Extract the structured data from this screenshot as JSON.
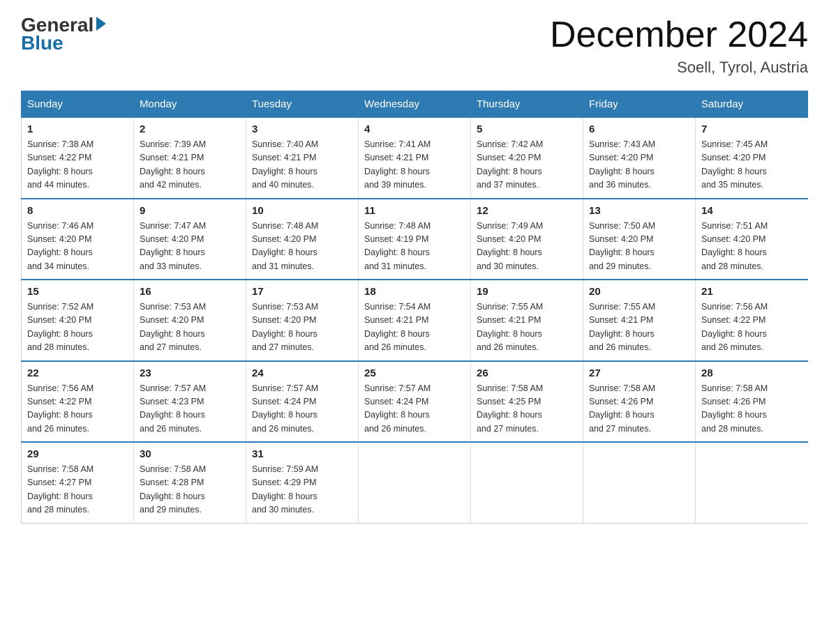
{
  "logo": {
    "general": "General",
    "blue": "Blue"
  },
  "title": "December 2024",
  "location": "Soell, Tyrol, Austria",
  "days_of_week": [
    "Sunday",
    "Monday",
    "Tuesday",
    "Wednesday",
    "Thursday",
    "Friday",
    "Saturday"
  ],
  "weeks": [
    [
      {
        "day": "1",
        "sunrise": "7:38 AM",
        "sunset": "4:22 PM",
        "daylight": "8 hours and 44 minutes."
      },
      {
        "day": "2",
        "sunrise": "7:39 AM",
        "sunset": "4:21 PM",
        "daylight": "8 hours and 42 minutes."
      },
      {
        "day": "3",
        "sunrise": "7:40 AM",
        "sunset": "4:21 PM",
        "daylight": "8 hours and 40 minutes."
      },
      {
        "day": "4",
        "sunrise": "7:41 AM",
        "sunset": "4:21 PM",
        "daylight": "8 hours and 39 minutes."
      },
      {
        "day": "5",
        "sunrise": "7:42 AM",
        "sunset": "4:20 PM",
        "daylight": "8 hours and 37 minutes."
      },
      {
        "day": "6",
        "sunrise": "7:43 AM",
        "sunset": "4:20 PM",
        "daylight": "8 hours and 36 minutes."
      },
      {
        "day": "7",
        "sunrise": "7:45 AM",
        "sunset": "4:20 PM",
        "daylight": "8 hours and 35 minutes."
      }
    ],
    [
      {
        "day": "8",
        "sunrise": "7:46 AM",
        "sunset": "4:20 PM",
        "daylight": "8 hours and 34 minutes."
      },
      {
        "day": "9",
        "sunrise": "7:47 AM",
        "sunset": "4:20 PM",
        "daylight": "8 hours and 33 minutes."
      },
      {
        "day": "10",
        "sunrise": "7:48 AM",
        "sunset": "4:20 PM",
        "daylight": "8 hours and 31 minutes."
      },
      {
        "day": "11",
        "sunrise": "7:48 AM",
        "sunset": "4:19 PM",
        "daylight": "8 hours and 31 minutes."
      },
      {
        "day": "12",
        "sunrise": "7:49 AM",
        "sunset": "4:20 PM",
        "daylight": "8 hours and 30 minutes."
      },
      {
        "day": "13",
        "sunrise": "7:50 AM",
        "sunset": "4:20 PM",
        "daylight": "8 hours and 29 minutes."
      },
      {
        "day": "14",
        "sunrise": "7:51 AM",
        "sunset": "4:20 PM",
        "daylight": "8 hours and 28 minutes."
      }
    ],
    [
      {
        "day": "15",
        "sunrise": "7:52 AM",
        "sunset": "4:20 PM",
        "daylight": "8 hours and 28 minutes."
      },
      {
        "day": "16",
        "sunrise": "7:53 AM",
        "sunset": "4:20 PM",
        "daylight": "8 hours and 27 minutes."
      },
      {
        "day": "17",
        "sunrise": "7:53 AM",
        "sunset": "4:20 PM",
        "daylight": "8 hours and 27 minutes."
      },
      {
        "day": "18",
        "sunrise": "7:54 AM",
        "sunset": "4:21 PM",
        "daylight": "8 hours and 26 minutes."
      },
      {
        "day": "19",
        "sunrise": "7:55 AM",
        "sunset": "4:21 PM",
        "daylight": "8 hours and 26 minutes."
      },
      {
        "day": "20",
        "sunrise": "7:55 AM",
        "sunset": "4:21 PM",
        "daylight": "8 hours and 26 minutes."
      },
      {
        "day": "21",
        "sunrise": "7:56 AM",
        "sunset": "4:22 PM",
        "daylight": "8 hours and 26 minutes."
      }
    ],
    [
      {
        "day": "22",
        "sunrise": "7:56 AM",
        "sunset": "4:22 PM",
        "daylight": "8 hours and 26 minutes."
      },
      {
        "day": "23",
        "sunrise": "7:57 AM",
        "sunset": "4:23 PM",
        "daylight": "8 hours and 26 minutes."
      },
      {
        "day": "24",
        "sunrise": "7:57 AM",
        "sunset": "4:24 PM",
        "daylight": "8 hours and 26 minutes."
      },
      {
        "day": "25",
        "sunrise": "7:57 AM",
        "sunset": "4:24 PM",
        "daylight": "8 hours and 26 minutes."
      },
      {
        "day": "26",
        "sunrise": "7:58 AM",
        "sunset": "4:25 PM",
        "daylight": "8 hours and 27 minutes."
      },
      {
        "day": "27",
        "sunrise": "7:58 AM",
        "sunset": "4:26 PM",
        "daylight": "8 hours and 27 minutes."
      },
      {
        "day": "28",
        "sunrise": "7:58 AM",
        "sunset": "4:26 PM",
        "daylight": "8 hours and 28 minutes."
      }
    ],
    [
      {
        "day": "29",
        "sunrise": "7:58 AM",
        "sunset": "4:27 PM",
        "daylight": "8 hours and 28 minutes."
      },
      {
        "day": "30",
        "sunrise": "7:58 AM",
        "sunset": "4:28 PM",
        "daylight": "8 hours and 29 minutes."
      },
      {
        "day": "31",
        "sunrise": "7:59 AM",
        "sunset": "4:29 PM",
        "daylight": "8 hours and 30 minutes."
      },
      null,
      null,
      null,
      null
    ]
  ],
  "labels": {
    "sunrise": "Sunrise:",
    "sunset": "Sunset:",
    "daylight": "Daylight:"
  }
}
